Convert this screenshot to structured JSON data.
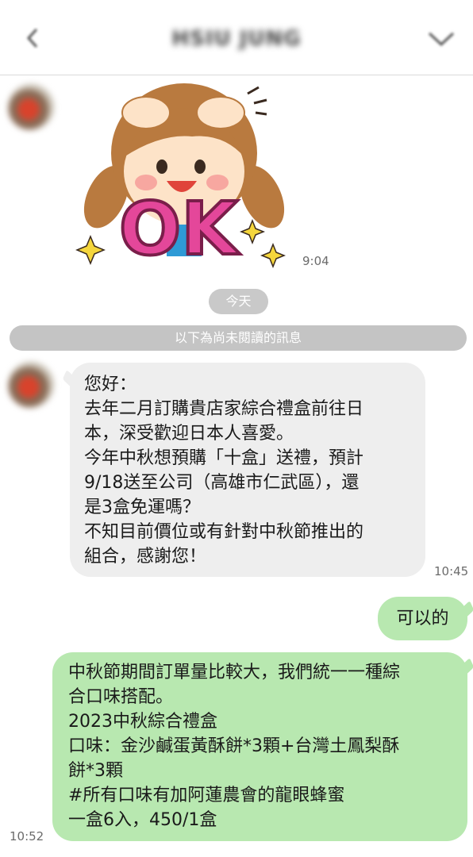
{
  "header": {
    "title": "HSIU JUNG",
    "back_icon": "chevron-left-icon",
    "menu_icon": "chevron-down-icon"
  },
  "sticker": {
    "text": "OK",
    "time": "9:04"
  },
  "date_separator": "今天",
  "unread_notice": "以下為尚未閱讀的訊息",
  "incoming_message": {
    "lines": [
      "您好：",
      "去年二月訂購貴店家綜合禮盒前往日",
      "本，深受歡迎日本人喜愛。",
      "今年中秋想預購「十盒」送禮，預計",
      "9/18送至公司（高雄市仁武區），還",
      "是3盒免運嗎？",
      "不知目前價位或有針對中秋節推出的",
      "組合，感謝您！"
    ],
    "time": "10:45"
  },
  "outgoing_short": {
    "text": "可以的"
  },
  "outgoing_long": {
    "lines": [
      "中秋節期間訂單量比較大，我們統一一種綜",
      "合口味搭配。",
      "2023中秋綜合禮盒",
      "口味：金沙鹹蛋黃酥餅*3顆+台灣土鳳梨酥",
      "餅*3顆",
      "#所有口味有加阿蓮農會的龍眼蜂蜜",
      "一盒6入，450/1盒"
    ],
    "time": "10:52"
  },
  "colors": {
    "outgoing_bubble": "#b8e8b0",
    "incoming_bubble": "#eeeeee",
    "pill": "#c9c9c9"
  }
}
